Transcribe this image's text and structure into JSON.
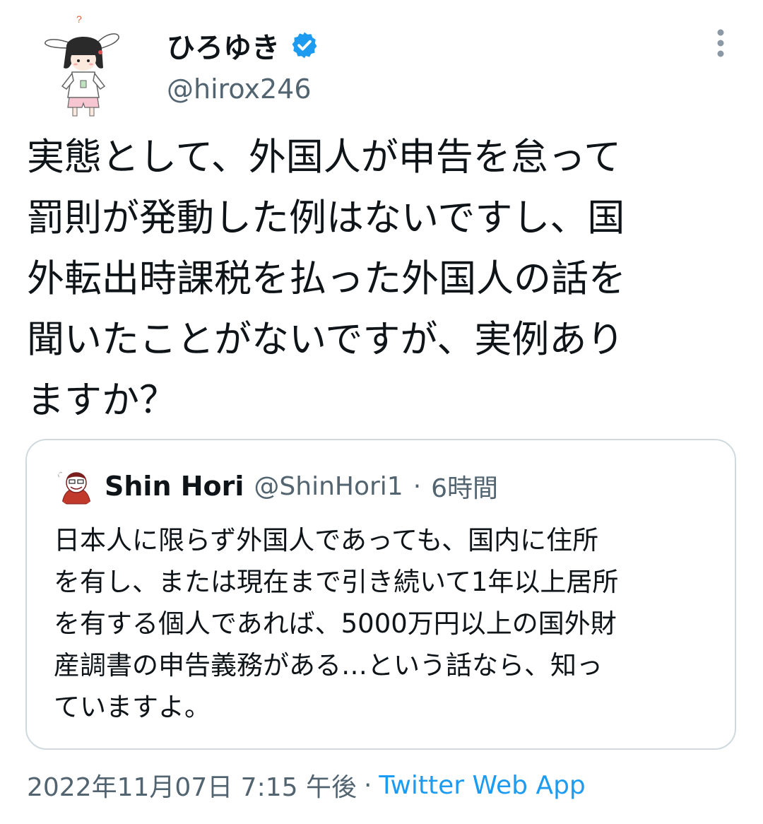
{
  "author": {
    "name": "ひろゆき",
    "handle": "@hirox246",
    "avatar_icon": "bunny-ear-girl-avatar",
    "verified_icon": "verified-badge-icon"
  },
  "tweet": {
    "text": "実態として、外国人が申告を怠って\n罰則が発動した例はないですし、国\n外転出時課税を払った外国人の話を\n聞いたことがないですが、実例あり\nますか？"
  },
  "quoted_tweet": {
    "name": "Shin Hori",
    "handle": "@ShinHori1",
    "separator": "·",
    "time": "6時間",
    "text": "日本人に限らず外国人であっても、国内に住所\nを有し、または現在まで引き続いて1年以上居所\nを有する個人であれば、5000万円以上の国外財\n産調書の申告義務がある…という話なら、知っ\nていますよ。"
  },
  "meta": {
    "datetime": "2022年11月07日 7:15 午後",
    "separator": "·",
    "source": "Twitter Web App"
  },
  "colors": {
    "accent": "#1d9bf0",
    "secondary_text": "#536471",
    "border": "#cfd9de"
  }
}
